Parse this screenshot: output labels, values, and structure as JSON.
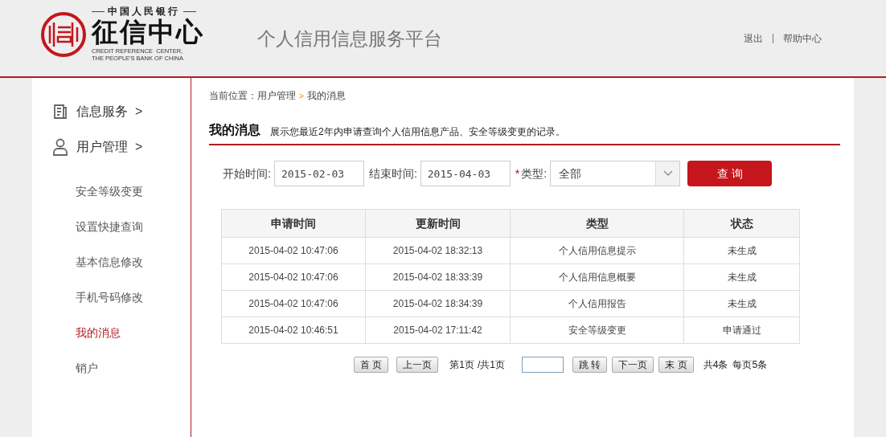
{
  "logo": {
    "top_line": "中国人民银行",
    "name": "征信中心",
    "english": [
      "CREDIT REFERENCE  CENTER,",
      "THE PEOPLE'S BANK OF CHINA"
    ]
  },
  "platform_title": "个人信用信息服务平台",
  "header_links": [
    "退出",
    "帮助中心"
  ],
  "sidebar": {
    "sections": [
      {
        "label": "信息服务",
        "arrow": ">",
        "kind": "document"
      },
      {
        "label": "用户管理",
        "arrow": ">",
        "kind": "user"
      }
    ],
    "items": [
      {
        "label": "安全等级变更",
        "selected": false
      },
      {
        "label": "设置快捷查询",
        "selected": false
      },
      {
        "label": "基本信息修改",
        "selected": false
      },
      {
        "label": "手机号码修改",
        "selected": false
      },
      {
        "label": "我的消息",
        "selected": true
      },
      {
        "label": "销户",
        "selected": false
      }
    ]
  },
  "breadcrumb": {
    "prefix": "当前位置：用户管理",
    "separator": ">",
    "current": "我的消息"
  },
  "page_title": "我的消息",
  "page_description": "展示您最近2年内申请查询个人信用信息产品、安全等级变更的记录。",
  "filters": {
    "start_label": "开始时间:",
    "start_value": "2015-02-03",
    "end_label": "结束时间:",
    "end_value": "2015-04-03",
    "type_required": "*",
    "type_label": "类型:",
    "type_value": "全部",
    "search_button": "查 询"
  },
  "table": {
    "columns": [
      "申请时间",
      "更新时间",
      "类型",
      "状态"
    ],
    "rows": [
      [
        "2015-04-02 10:47:06",
        "2015-04-02 18:32:13",
        "个人信用信息提示",
        "未生成"
      ],
      [
        "2015-04-02 10:47:06",
        "2015-04-02 18:33:39",
        "个人信用信息概要",
        "未生成"
      ],
      [
        "2015-04-02 10:47:06",
        "2015-04-02 18:34:39",
        "个人信用报告",
        "未生成"
      ],
      [
        "2015-04-02 10:46:51",
        "2015-04-02 17:11:42",
        "安全等级变更",
        "申请通过"
      ]
    ]
  },
  "pagination": {
    "first": "首 页",
    "prev": "上一页",
    "page_info": "第1页",
    "total_pages": "/共1页",
    "jump": "跳 转",
    "next": "下一页",
    "last": "末 页",
    "total": "共4条",
    "per_page": "每页5条"
  }
}
